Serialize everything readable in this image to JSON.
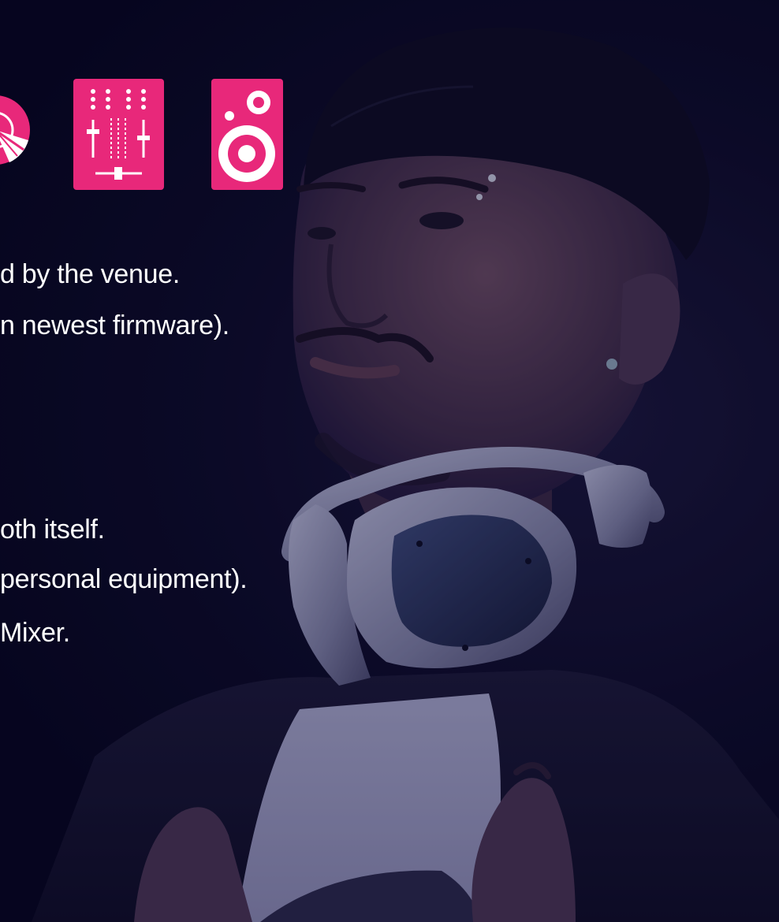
{
  "content": {
    "lines": [
      "d by the venue.",
      "n newest firmware).",
      ",",
      "oth itself.",
      "personal equipment).",
      "Mixer."
    ]
  },
  "colors": {
    "accent": "#e8287a",
    "background": "#06051a",
    "text": "#ffffff"
  },
  "icons": [
    "turntable-icon",
    "mixer-icon",
    "speaker-icon"
  ]
}
